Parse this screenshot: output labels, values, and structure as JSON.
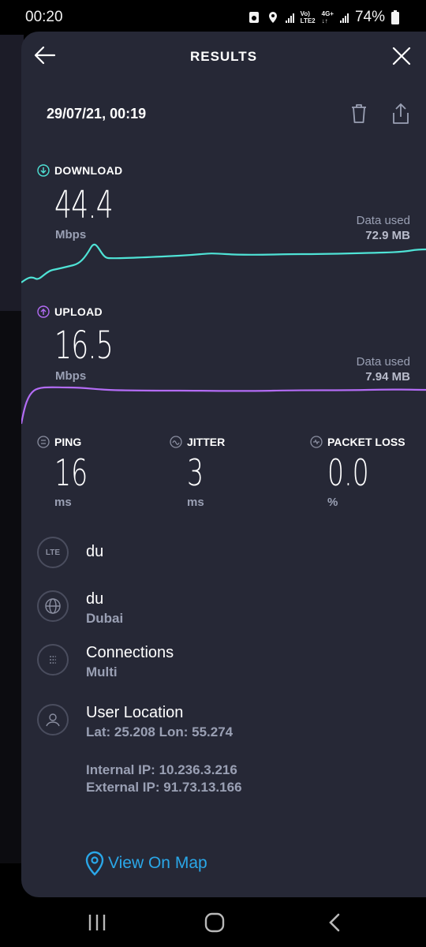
{
  "status_bar": {
    "time": "00:20",
    "net_top": "Vo)",
    "net_bottom": "LTE2",
    "net_type": "4G+",
    "battery": "74%"
  },
  "header": {
    "title": "RESULTS"
  },
  "result": {
    "datetime": "29/07/21, 00:19"
  },
  "download": {
    "label": "DOWNLOAD",
    "value": "44.4",
    "unit": "Mbps",
    "data_used_label": "Data used",
    "data_used_value": "72.9 MB",
    "color": "#4fe3d6"
  },
  "upload": {
    "label": "UPLOAD",
    "value": "16.5",
    "unit": "Mbps",
    "data_used_label": "Data used",
    "data_used_value": "7.94 MB",
    "color": "#b36cf5"
  },
  "metrics": {
    "ping": {
      "label": "PING",
      "value": "16",
      "unit": "ms"
    },
    "jitter": {
      "label": "JITTER",
      "value": "3",
      "unit": "ms"
    },
    "packet_loss": {
      "label": "PACKET LOSS",
      "value": "0.0",
      "unit": "%"
    }
  },
  "info": {
    "provider": {
      "icon_text": "LTE",
      "name": "du"
    },
    "server": {
      "name": "du",
      "city": "Dubai"
    },
    "connections": {
      "title": "Connections",
      "value": "Multi"
    },
    "location": {
      "title": "User Location",
      "coords": "Lat: 25.208 Lon: 55.274"
    },
    "internal_ip": "Internal IP: 10.236.3.216",
    "external_ip": "External IP: 91.73.13.166"
  },
  "map_link": {
    "label": "View On Map",
    "color": "#2aa7e8"
  }
}
